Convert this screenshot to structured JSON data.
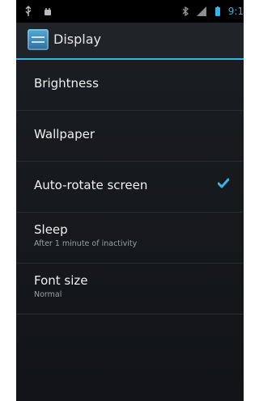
{
  "status": {
    "time": "9:1"
  },
  "header": {
    "title": "Display"
  },
  "settings": [
    {
      "label": "Brightness"
    },
    {
      "label": "Wallpaper"
    },
    {
      "label": "Auto-rotate screen",
      "checked": true
    },
    {
      "label": "Sleep",
      "summary": "After 1 minute of inactivity"
    },
    {
      "label": "Font size",
      "summary": "Normal"
    }
  ],
  "colors": {
    "accent": "#33b5e5"
  }
}
